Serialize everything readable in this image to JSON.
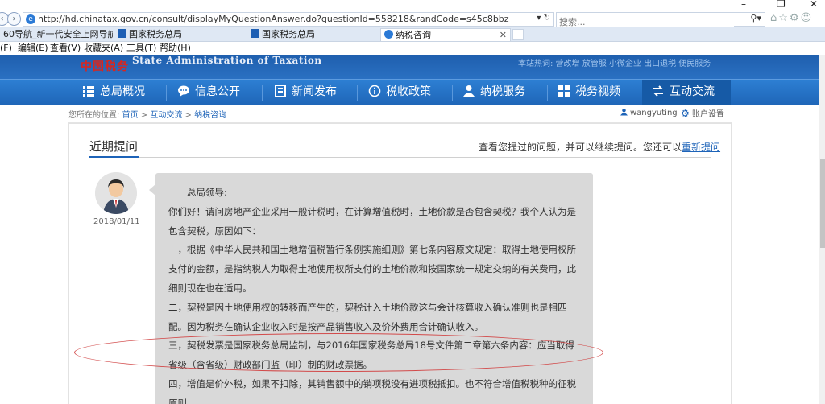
{
  "browser": {
    "url": "http://hd.chinatax.gov.cn/consult/displayMyQuestionAnswer.do?questionId=558218&randCode=s45c8bbz",
    "search_placeholder": "搜索...",
    "tabs": [
      {
        "label": "60导航_新一代安全上网导航"
      },
      {
        "label": "国家税务总局"
      },
      {
        "label": "国家税务总局"
      },
      {
        "label": "纳税咨询"
      }
    ],
    "menu": [
      "(F)",
      "编辑(E)",
      "查看(V)",
      "收藏夹(A)",
      "工具(T)",
      "帮助(H)"
    ]
  },
  "site": {
    "logo_cn": "中国税务",
    "logo_en": "State Administration of Taxation",
    "hotwords": "本站热词: 营改增 放管服 小微企业 出口退税 便民服务",
    "nav": [
      {
        "label": "总局概况",
        "icon": "menu-icon"
      },
      {
        "label": "信息公开",
        "icon": "chat-bubble-icon"
      },
      {
        "label": "新闻发布",
        "icon": "document-icon"
      },
      {
        "label": "税收政策",
        "icon": "info-icon"
      },
      {
        "label": "纳税服务",
        "icon": "person-icon"
      },
      {
        "label": "税务视频",
        "icon": "video-icon"
      },
      {
        "label": "互动交流",
        "icon": "exchange-arrows-icon",
        "active": true
      }
    ]
  },
  "breadcrumb": {
    "prefix": "您所在的位置:",
    "items": [
      "首页",
      "互动交流",
      "纳税咨询"
    ],
    "sep": ">",
    "username": "wangyuting",
    "settings": "账户设置"
  },
  "card": {
    "title": "近期提问",
    "right_text": "查看您提过的问题，并可以继续提问。您还可以",
    "right_link": "重新提问",
    "date": "2018/01/11",
    "message": [
      "　　总局领导:",
      "你们好！请问房地产企业采用一般计税时，在计算增值税时，土地价款是否包含契税？我个人认为是包含契税，原因如下：",
      "一，根据《中华人民共和国土地增值税暂行条例实施细则》第七条内容原文规定：取得土地使用权所支付的金额，是指纳税人为取得土地使用权所支付的土地价款和按国家统一规定交纳的有关费用，此细则现在也在适用。",
      "二，契税是因土地使用权的转移而产生的，契税计入土地价款这与会计核算收入确认准则也是相匹配。因为税务在确认企业收入时是按产品销售收入及价外费用合计确认收入。",
      "三，契税发票是国家税务总局监制，与2016年国家税务总局18号文件第二章第六条内容：应当取得省级（含省级）财政部门监（印）制的财政票据。",
      "四，增值是价外税，如果不扣除，其销售额中的销项税没有进项税抵扣。也不符合增值税税种的征税原则。"
    ]
  },
  "colors": {
    "nav_blue": "#2d7fd3",
    "nav_active": "#165aa6",
    "link_blue": "#1d63b8",
    "bubble_gray": "#d9d9d9",
    "annotation_red": "#d24a4a"
  }
}
